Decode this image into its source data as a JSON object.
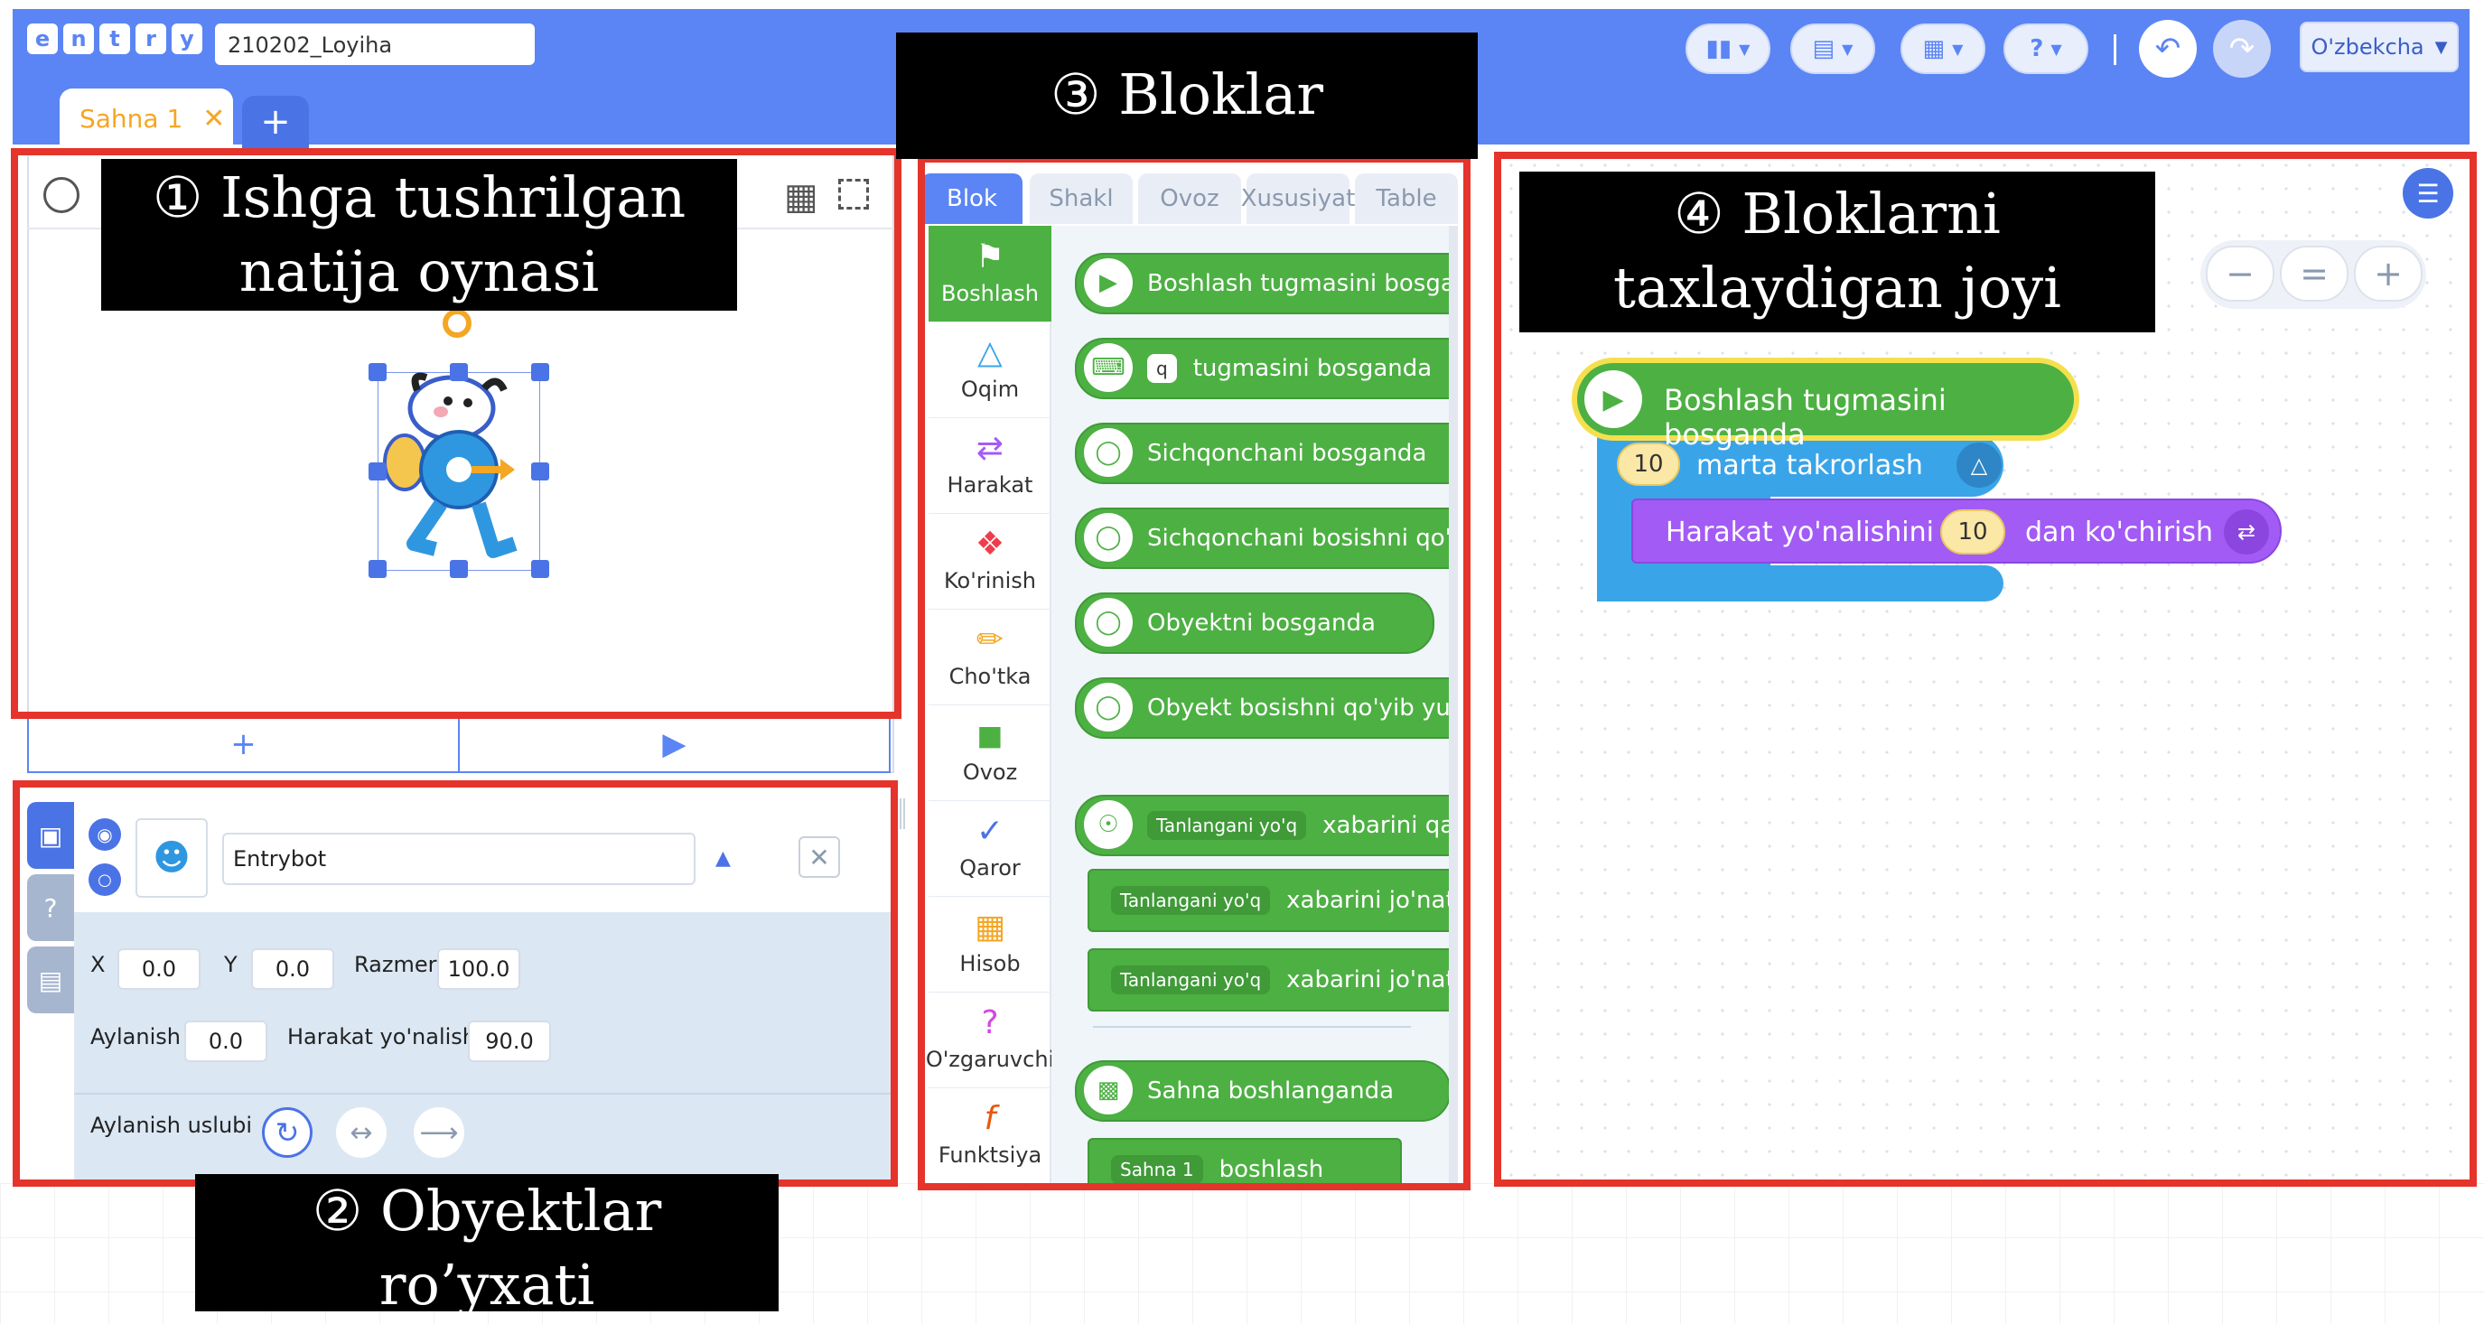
{
  "app": {
    "logo_letters": [
      "e",
      "n",
      "t",
      "r",
      "y"
    ],
    "project_name": "210202_Loyiha",
    "language": "O'zbekcha",
    "scene_tab": "Sahna 1"
  },
  "annotations": {
    "stage": [
      "① Ishga tushrilgan",
      "natija oynasi"
    ],
    "objects": [
      "② Obyektlar",
      "ro’yxati"
    ],
    "blocks": [
      "③ Bloklar"
    ],
    "workspace": [
      "④ Bloklarni",
      "taxlaydigan joyi"
    ]
  },
  "object": {
    "name": "Entrybot",
    "x_label": "X",
    "x": "0.0",
    "y_label": "Y",
    "y": "0.0",
    "size_label": "Razmer",
    "size": "100.0",
    "rotation_label": "Aylanish",
    "rotation": "0.0",
    "direction_label": "Harakat yo'nalish",
    "direction": "90.0",
    "rotation_style_label": "Aylanish uslubi"
  },
  "block_tabs": [
    "Blok",
    "Shakl",
    "Ovoz",
    "Xususiyat",
    "Table"
  ],
  "categories": [
    {
      "label": "Boshlash",
      "icon": "flag-icon",
      "color": "#4db043"
    },
    {
      "label": "Oqim",
      "icon": "flow-icon",
      "color": "#3aa4e8"
    },
    {
      "label": "Harakat",
      "icon": "arrows-icon",
      "color": "#a35bf5"
    },
    {
      "label": "Ko'rinish",
      "icon": "looks-icon",
      "color": "#ef3c4b"
    },
    {
      "label": "Cho'tka",
      "icon": "brush-icon",
      "color": "#f5a623"
    },
    {
      "label": "Ovoz",
      "icon": "speaker-icon",
      "color": "#4db043"
    },
    {
      "label": "Qaror",
      "icon": "check-icon",
      "color": "#4a73e6"
    },
    {
      "label": "Hisob",
      "icon": "calculator-icon",
      "color": "#f5a623"
    },
    {
      "label": "O'zgaruvchi",
      "icon": "question-icon",
      "color": "#d14be0"
    },
    {
      "label": "Funktsiya",
      "icon": "function-icon",
      "color": "#e8570c"
    }
  ],
  "palette_blocks": {
    "start_button": "Boshlash tugmasini bosganda",
    "key_value": "q",
    "key_text": "tugmasini bosganda",
    "mouse_click": "Sichqonchani bosganda",
    "mouse_release": "Sichqonchani bosishni qo'yib yuborganda",
    "object_click": "Obyektni bosganda",
    "object_release": "Obyekt bosishni qo'yib yuborganda",
    "signal_select": "Tanlangani yo'q",
    "signal_receive": "xabarini qabul qilganda",
    "signal_send": "xabarini jo'natish",
    "signal_send_wait": "xabarini jo'natish va kutish",
    "scene_start": "Sahna boshlanganda",
    "scene_select": "Sahna 1",
    "scene_action": "boshlash"
  },
  "script": {
    "hat": "Boshlash tugmasini bosganda",
    "repeat_count": "10",
    "repeat_text": "marta takrorlash",
    "move_text_before": "Harakat yo'nalishini",
    "move_value": "10",
    "move_text_after": "dan ko'chirish"
  },
  "colors": {
    "brand": "#5b85f4",
    "start": "#4db043",
    "flow": "#3aa4e8",
    "move": "#a35bf5",
    "annotation": "#e4342b",
    "hat_outline": "#f4e04d"
  }
}
